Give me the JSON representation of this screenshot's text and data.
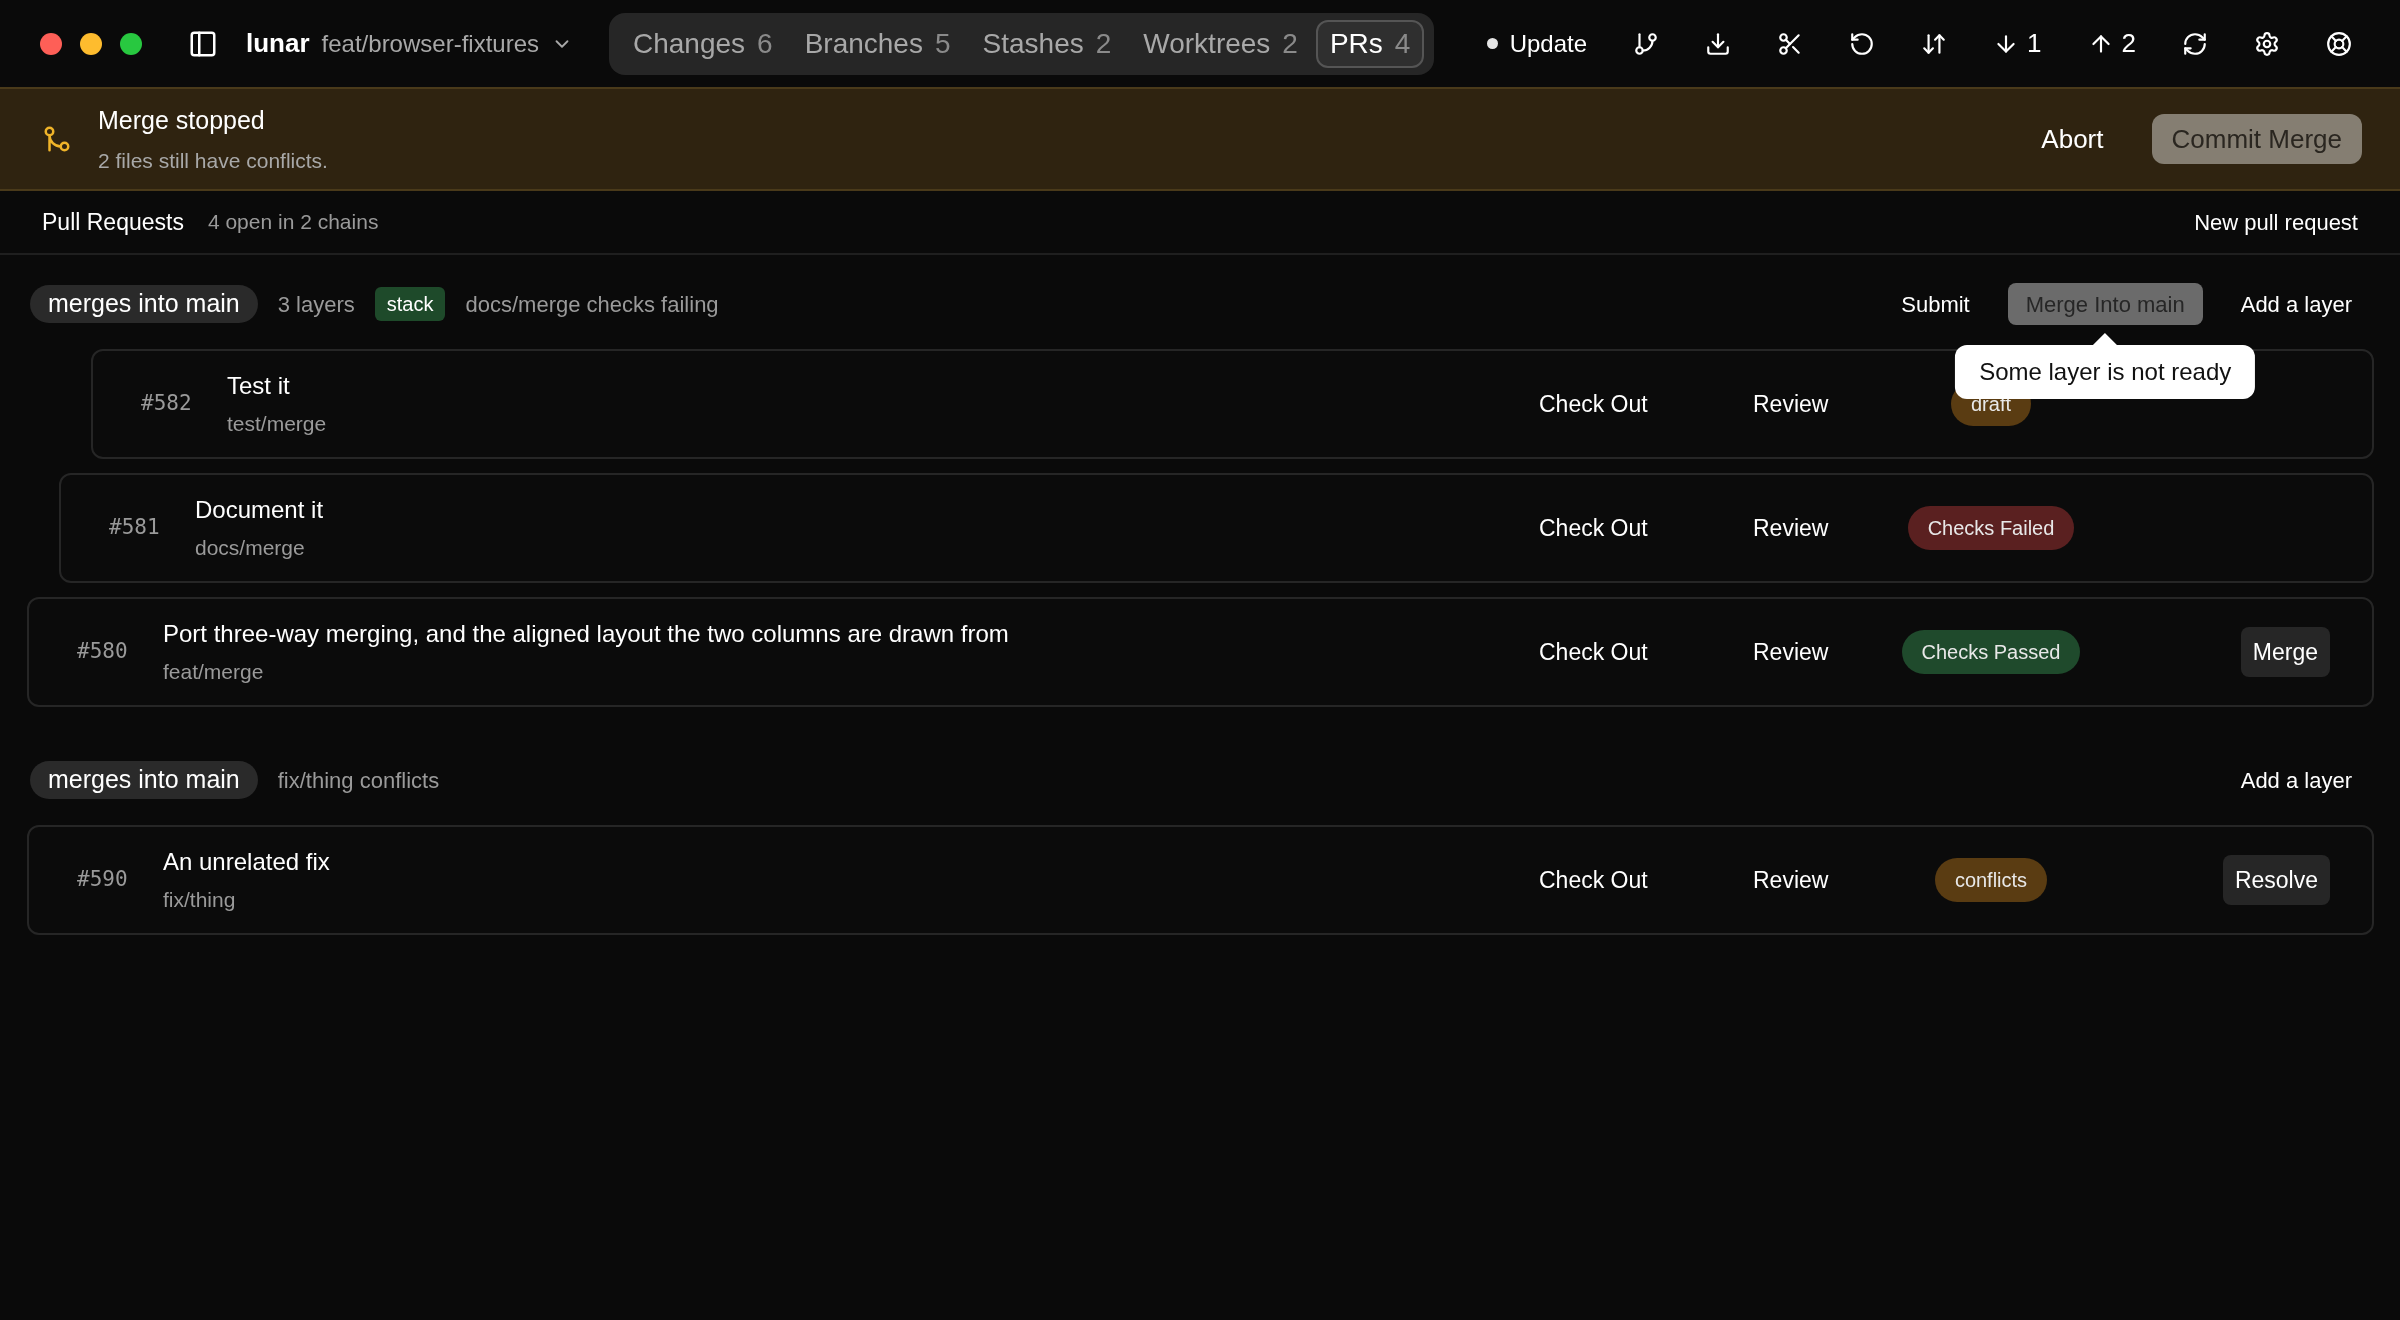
{
  "titlebar": {
    "repo": "lunar",
    "branch": "feat/browser-fixtures",
    "tabs": [
      {
        "label": "Changes",
        "count": "6",
        "selected": false
      },
      {
        "label": "Branches",
        "count": "5",
        "selected": false
      },
      {
        "label": "Stashes",
        "count": "2",
        "selected": false
      },
      {
        "label": "Worktrees",
        "count": "2",
        "selected": false
      },
      {
        "label": "PRs",
        "count": "4",
        "selected": true
      }
    ],
    "update": "Update",
    "tools": [
      {
        "kind": "branch"
      },
      {
        "kind": "download"
      },
      {
        "kind": "scissors"
      },
      {
        "kind": "undo"
      },
      {
        "kind": "swap"
      },
      {
        "kind": "pull",
        "count": "1"
      },
      {
        "kind": "push",
        "count": "2"
      },
      {
        "kind": "refresh"
      },
      {
        "kind": "settings"
      },
      {
        "kind": "help"
      }
    ]
  },
  "banner": {
    "title": "Merge stopped",
    "message": "2 files still have conflicts.",
    "abort": "Abort",
    "commit": {
      "label": "Commit Merge",
      "disabled": true
    }
  },
  "header": {
    "title": "Pull Requests",
    "summary": "4 open in 2 chains",
    "new": "New pull request"
  },
  "groups": [
    {
      "target": "merges into main",
      "layers": "3 layers",
      "tag": "stack",
      "note": "docs/merge checks failing",
      "actions": [
        {
          "label": "Submit",
          "disabled": false
        },
        {
          "label": "Merge Into main",
          "disabled": true,
          "tooltip": "Some layer is not ready"
        },
        {
          "label": "Add a layer",
          "disabled": false
        }
      ],
      "prs": [
        {
          "number": "#580",
          "title": "Port three-way merging, and the aligned layout the two columns are drawn from",
          "branch": "feat/merge",
          "checkout": "Check Out",
          "review": "Review",
          "status": {
            "label": "Checks Passed",
            "color": "#1f4a2c"
          },
          "action": "Merge",
          "children": [
            {
              "number": "#581",
              "title": "Document it",
              "branch": "docs/merge",
              "checkout": "Check Out",
              "review": "Review",
              "status": {
                "label": "Checks Failed",
                "color": "#5a2020"
              },
              "children": [
                {
                  "number": "#582",
                  "title": "Test it",
                  "branch": "test/merge",
                  "checkout": "Check Out",
                  "review": "Review",
                  "status": {
                    "label": "draft",
                    "color": "#5a3c12"
                  }
                }
              ]
            }
          ]
        }
      ]
    },
    {
      "target": "merges into main",
      "note": "fix/thing conflicts",
      "actions": [
        {
          "label": "Add a layer",
          "disabled": false
        }
      ],
      "prs": [
        {
          "number": "#590",
          "title": "An unrelated fix",
          "branch": "fix/thing",
          "checkout": "Check Out",
          "review": "Review",
          "status": {
            "label": "conflicts",
            "color": "#5a3c12"
          },
          "action": "Resolve"
        }
      ]
    }
  ]
}
